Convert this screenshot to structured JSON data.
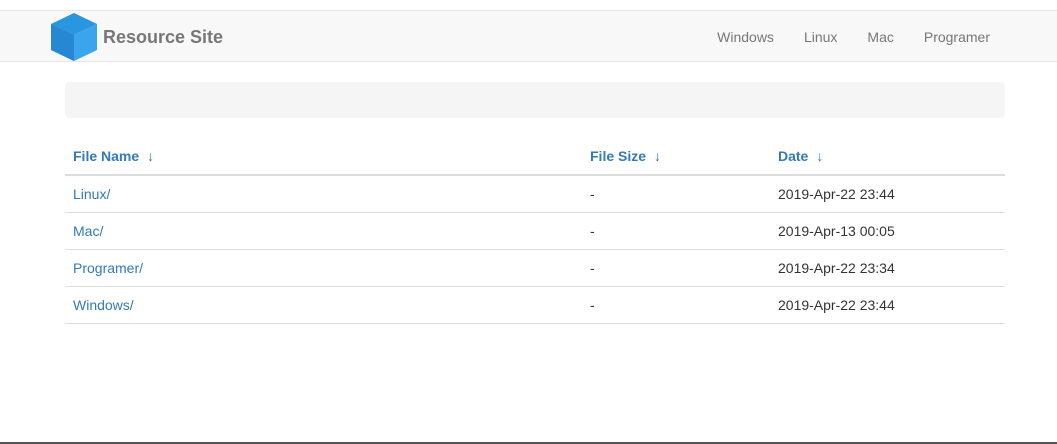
{
  "brand": {
    "name": "Resource Site",
    "logo_icon": "blue-box-icon",
    "logo_color": "#2d8fdb"
  },
  "nav": {
    "items": [
      {
        "label": "Windows"
      },
      {
        "label": "Linux"
      },
      {
        "label": "Mac"
      },
      {
        "label": "Programer"
      }
    ]
  },
  "table": {
    "headers": {
      "name": "File Name",
      "size": "File Size",
      "date": "Date",
      "sort_arrow": "↓"
    },
    "rows": [
      {
        "name": "Linux/",
        "size": "-",
        "date": "2019-Apr-22 23:44"
      },
      {
        "name": "Mac/",
        "size": "-",
        "date": "2019-Apr-13 00:05"
      },
      {
        "name": "Programer/",
        "size": "-",
        "date": "2019-Apr-22 23:34"
      },
      {
        "name": "Windows/",
        "size": "-",
        "date": "2019-Apr-22 23:44"
      }
    ]
  },
  "colors": {
    "link": "#337ab7",
    "navbar_bg": "#f8f8f8",
    "well_bg": "#f5f5f5"
  }
}
